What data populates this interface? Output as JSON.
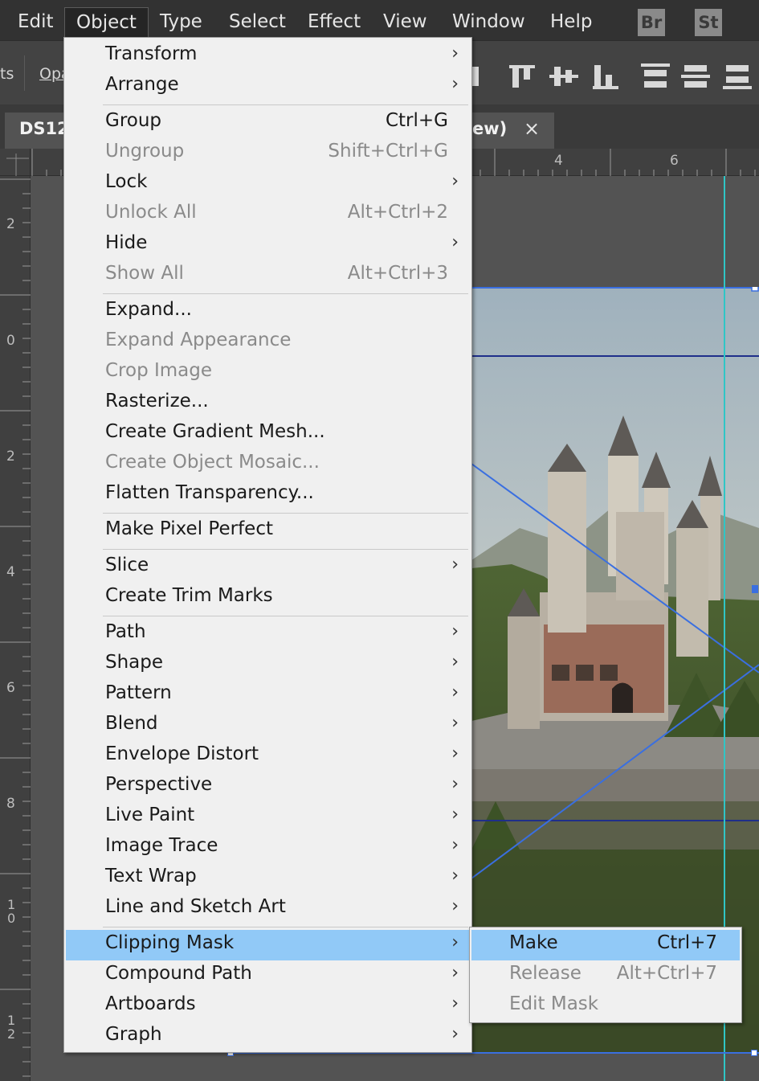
{
  "menubar": {
    "items": [
      "Edit",
      "Object",
      "Type",
      "Select",
      "Effect",
      "View",
      "Window",
      "Help"
    ],
    "active": "Object",
    "apps": [
      "Br",
      "St"
    ]
  },
  "controlbar": {
    "partial_left": "ts",
    "opacity_label": "Opa"
  },
  "tabs": {
    "doc_title_partial": "DS12",
    "view_title_partial": "ew)",
    "close_glyph": "×"
  },
  "rulers": {
    "horizontal": [
      "4",
      "6"
    ],
    "vertical": [
      "2",
      "0",
      "2",
      "4",
      "6",
      "8",
      "1\n0",
      "1\n2"
    ]
  },
  "object_menu": {
    "groups": [
      [
        {
          "label": "Transform",
          "submenu": true
        },
        {
          "label": "Arrange",
          "submenu": true
        }
      ],
      [
        {
          "label": "Group",
          "shortcut": "Ctrl+G"
        },
        {
          "label": "Ungroup",
          "shortcut": "Shift+Ctrl+G",
          "disabled": true
        },
        {
          "label": "Lock",
          "submenu": true
        },
        {
          "label": "Unlock All",
          "shortcut": "Alt+Ctrl+2",
          "disabled": true
        },
        {
          "label": "Hide",
          "submenu": true
        },
        {
          "label": "Show All",
          "shortcut": "Alt+Ctrl+3",
          "disabled": true
        }
      ],
      [
        {
          "label": "Expand..."
        },
        {
          "label": "Expand Appearance",
          "disabled": true
        },
        {
          "label": "Crop Image",
          "disabled": true
        },
        {
          "label": "Rasterize..."
        },
        {
          "label": "Create Gradient Mesh..."
        },
        {
          "label": "Create Object Mosaic...",
          "disabled": true
        },
        {
          "label": "Flatten Transparency..."
        }
      ],
      [
        {
          "label": "Make Pixel Perfect"
        }
      ],
      [
        {
          "label": "Slice",
          "submenu": true
        },
        {
          "label": "Create Trim Marks"
        }
      ],
      [
        {
          "label": "Path",
          "submenu": true
        },
        {
          "label": "Shape",
          "submenu": true
        },
        {
          "label": "Pattern",
          "submenu": true
        },
        {
          "label": "Blend",
          "submenu": true
        },
        {
          "label": "Envelope Distort",
          "submenu": true
        },
        {
          "label": "Perspective",
          "submenu": true
        },
        {
          "label": "Live Paint",
          "submenu": true
        },
        {
          "label": "Image Trace",
          "submenu": true
        },
        {
          "label": "Text Wrap",
          "submenu": true
        },
        {
          "label": "Line and Sketch Art",
          "submenu": true
        }
      ],
      [
        {
          "label": "Clipping Mask",
          "submenu": true,
          "highlight": true
        },
        {
          "label": "Compound Path",
          "submenu": true
        },
        {
          "label": "Artboards",
          "submenu": true
        },
        {
          "label": "Graph",
          "submenu": true
        }
      ]
    ],
    "arrow_glyph": "›"
  },
  "clipping_submenu": [
    {
      "label": "Make",
      "shortcut": "Ctrl+7",
      "highlight": true
    },
    {
      "label": "Release",
      "shortcut": "Alt+Ctrl+7",
      "disabled": true
    },
    {
      "label": "Edit Mask",
      "disabled": true
    }
  ],
  "colors": {
    "highlight": "#91c9f7",
    "guide": "#2fc6c6",
    "selection": "#3a6fe0"
  }
}
